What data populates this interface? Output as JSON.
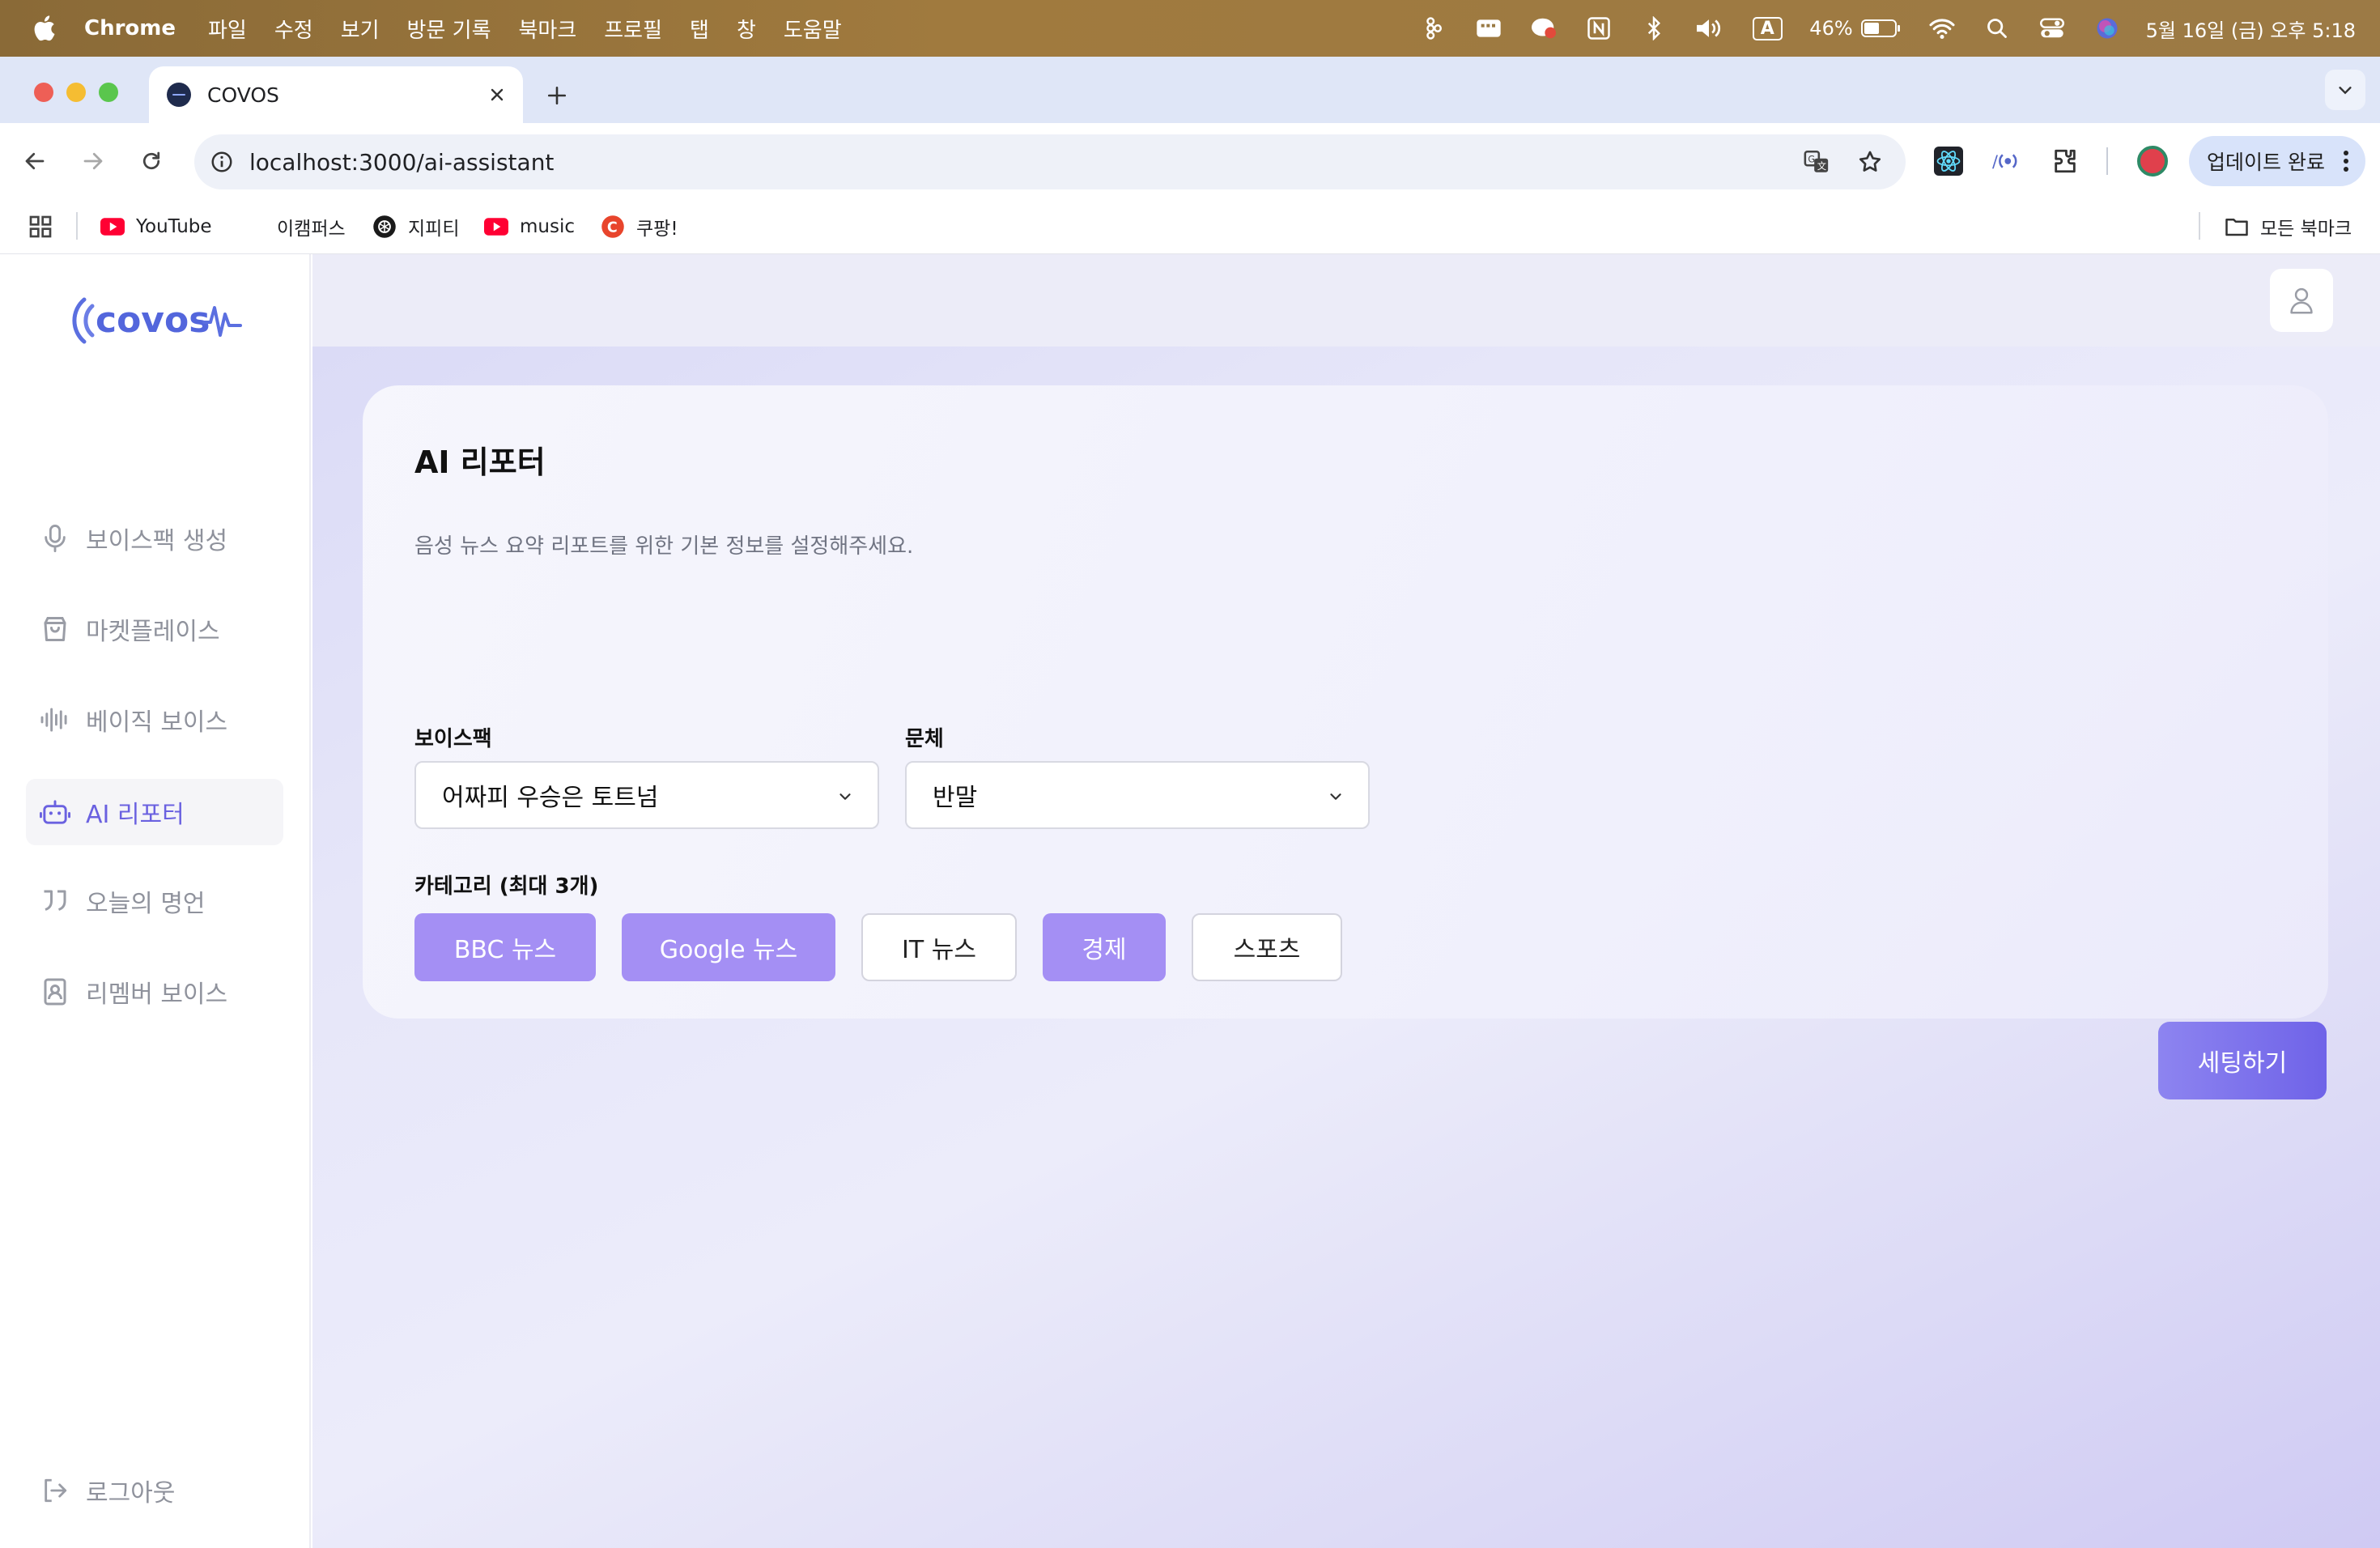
{
  "menubar": {
    "app_name": "Chrome",
    "items": [
      "파일",
      "수정",
      "보기",
      "방문 기록",
      "북마크",
      "프로필",
      "탭",
      "창",
      "도움말"
    ],
    "battery": "46%",
    "datetime": "5월 16일 (금) 오후 5:18",
    "input_indicator": "A"
  },
  "browser": {
    "tab_title": "COVOS",
    "url": "localhost:3000/ai-assistant",
    "update_label": "업데이트 완료",
    "bookmarks": [
      "YouTube",
      "이캠퍼스",
      "지피티",
      "music",
      "쿠팡!"
    ],
    "all_bookmarks": "모든 북마크"
  },
  "sidebar": {
    "logo_text": "covos",
    "items": [
      {
        "label": "보이스팩 생성",
        "icon": "microphone-icon"
      },
      {
        "label": "마켓플레이스",
        "icon": "shopping-bag-icon"
      },
      {
        "label": "베이직 보이스",
        "icon": "waveform-icon"
      },
      {
        "label": "AI 리포터",
        "icon": "bot-icon"
      },
      {
        "label": "오늘의 명언",
        "icon": "quote-icon"
      },
      {
        "label": "리멤버 보이스",
        "icon": "contact-book-icon"
      }
    ],
    "active_index": 3,
    "logout": "로그아웃"
  },
  "main": {
    "title": "AI 리포터",
    "description": "음성 뉴스 요약 리포트를 위한 기본 정보를 설정해주세요.",
    "voicepack_label": "보이스팩",
    "voicepack_value": "어짜피 우승은 토트넘",
    "style_label": "문체",
    "style_value": "반말",
    "category_label": "카테고리 (최대 3개)",
    "categories": [
      {
        "label": "BBC 뉴스",
        "selected": true
      },
      {
        "label": "Google 뉴스",
        "selected": true
      },
      {
        "label": "IT 뉴스",
        "selected": false
      },
      {
        "label": "경제",
        "selected": true
      },
      {
        "label": "스포츠",
        "selected": false
      }
    ],
    "submit_label": "세팅하기"
  },
  "colors": {
    "accent": "#6a61e0",
    "chip_selected": "#a48ff4",
    "button": "#7a6fec"
  }
}
